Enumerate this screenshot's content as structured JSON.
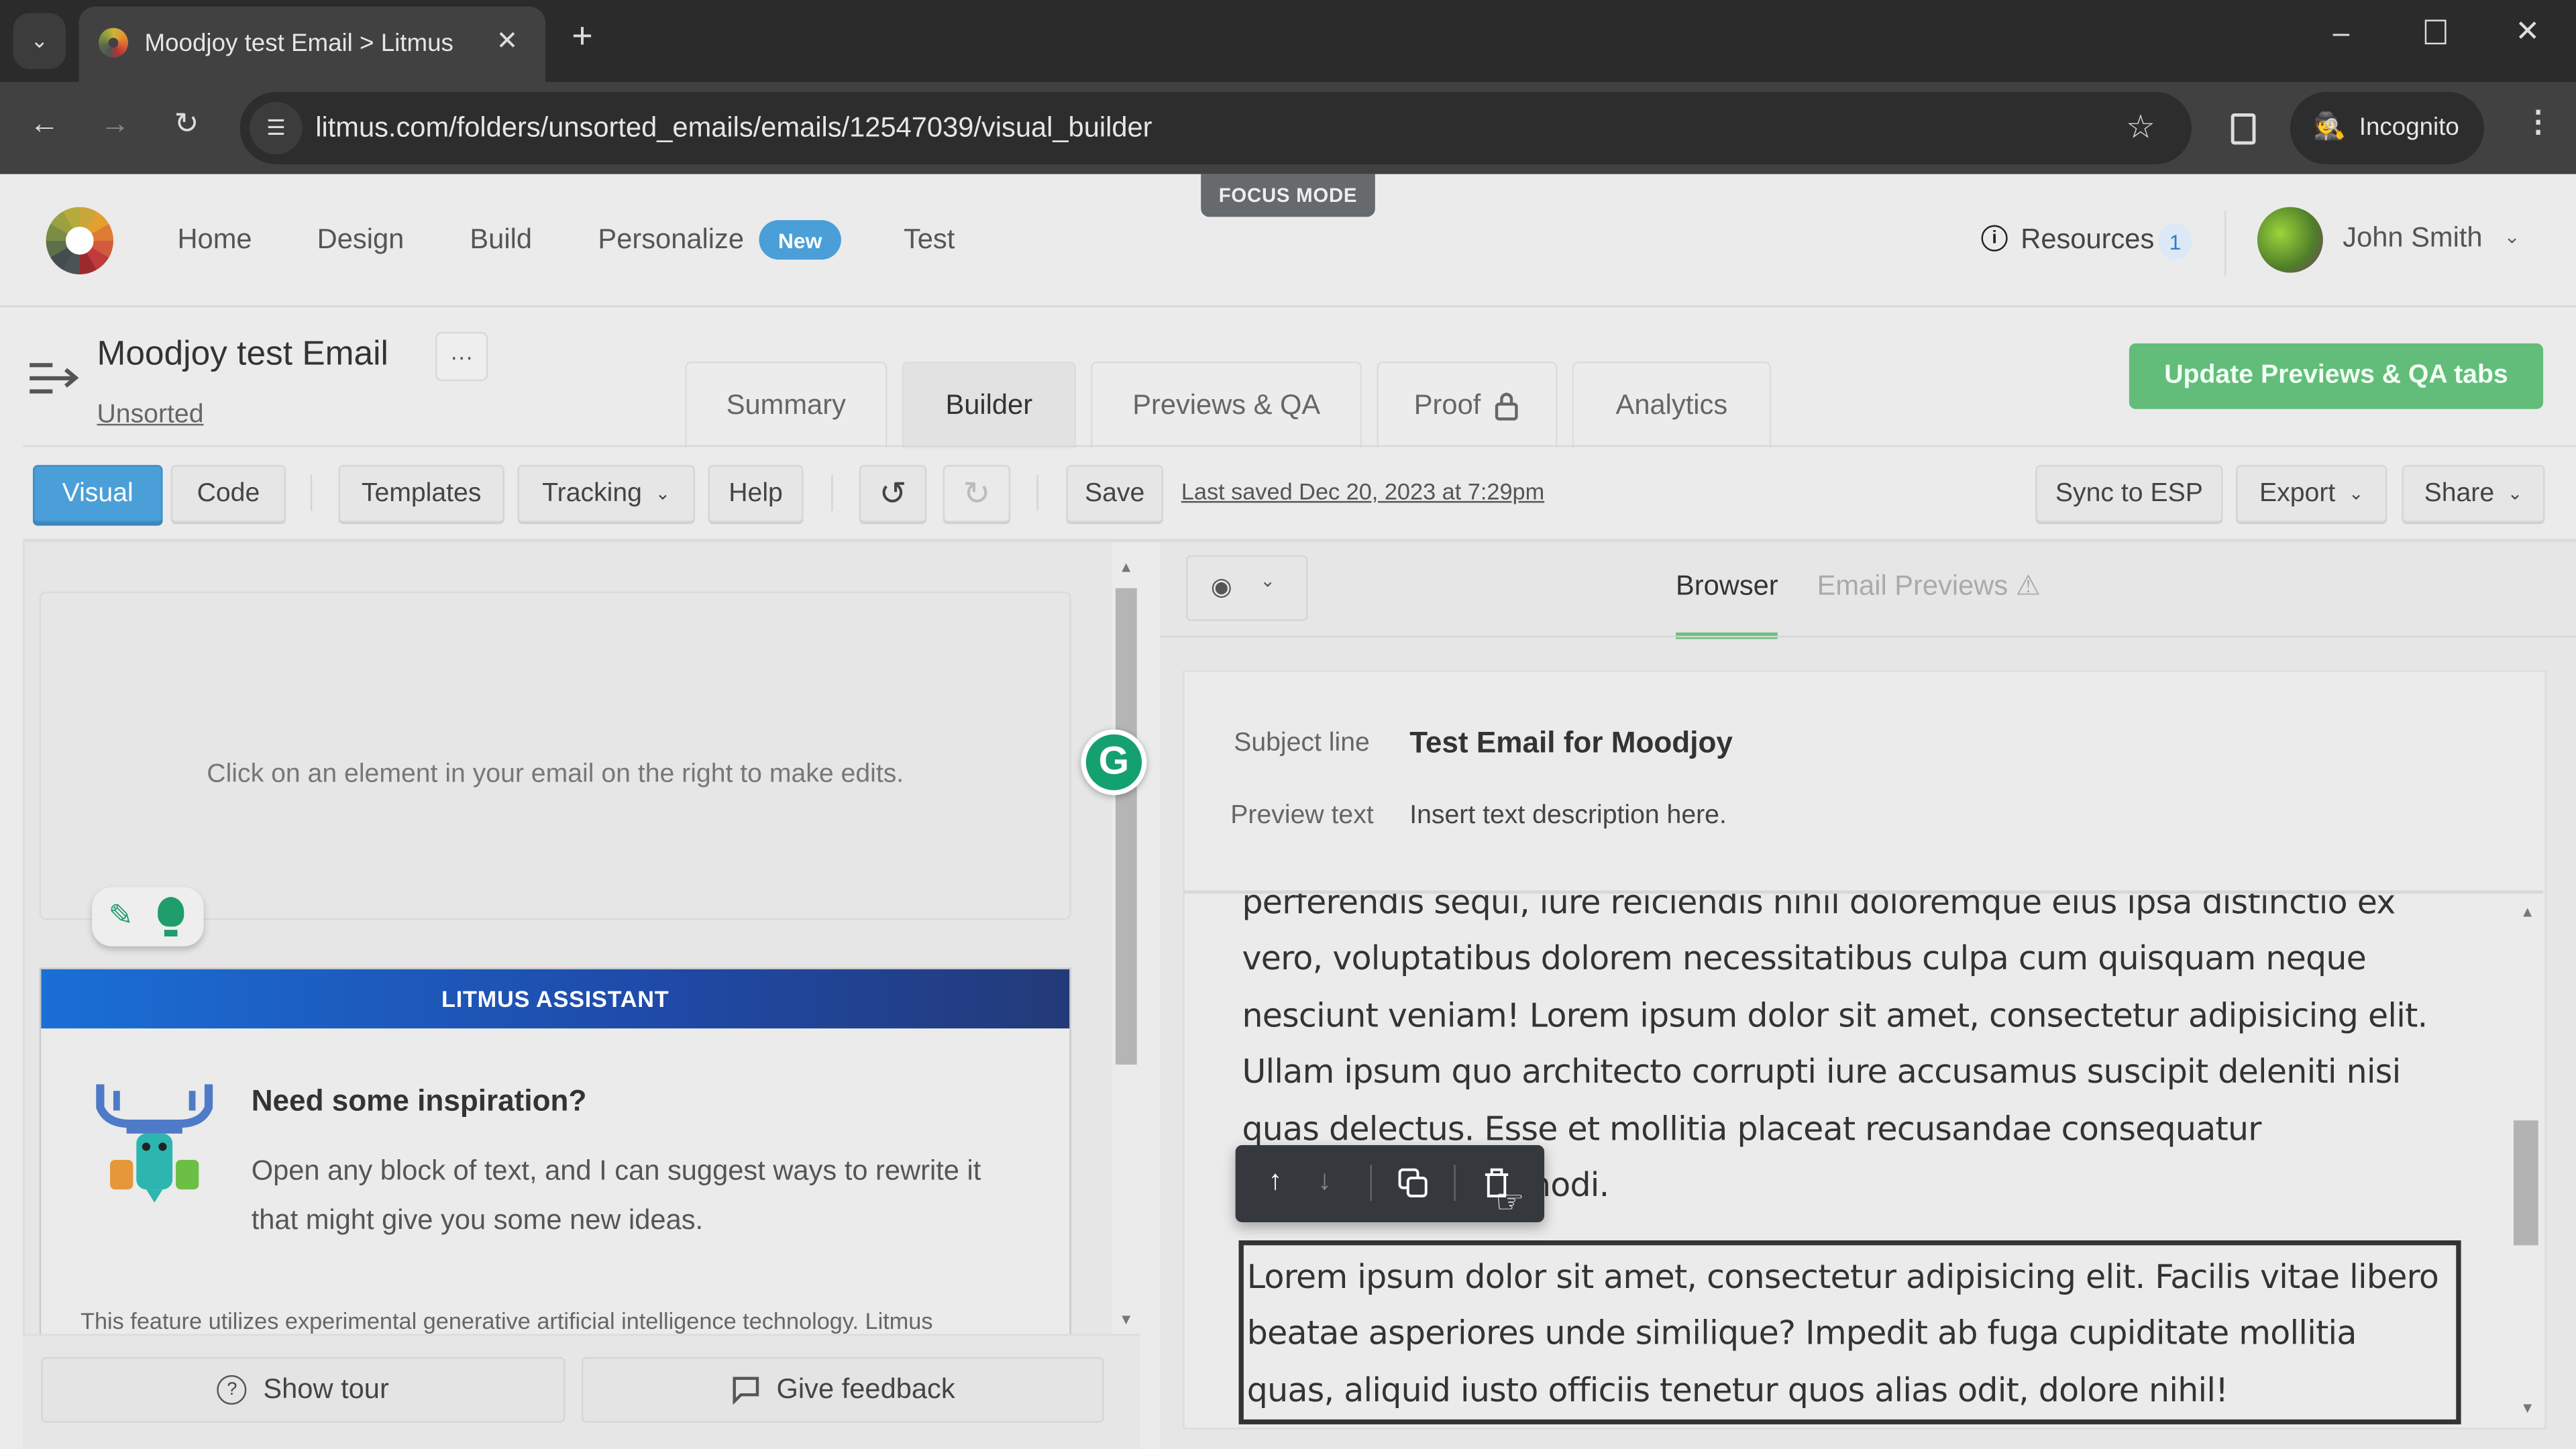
{
  "browser": {
    "tab_title": "Moodjoy test Email > Litmus",
    "url": "litmus.com/folders/unsorted_emails/emails/12547039/visual_builder",
    "profile_label": "Incognito"
  },
  "header": {
    "nav": [
      "Home",
      "Design",
      "Build",
      "Personalize",
      "Test"
    ],
    "new_badge": "New",
    "focus_mode": "FOCUS MODE",
    "resources_label": "Resources",
    "resources_count": "1",
    "user_name": "John Smith"
  },
  "email": {
    "title": "Moodjoy test Email",
    "more_label": "···",
    "folder": "Unsorted",
    "update_button": "Update Previews & QA tabs"
  },
  "page_tabs": [
    {
      "label": "Summary",
      "active": false
    },
    {
      "label": "Builder",
      "active": true
    },
    {
      "label": "Previews & QA",
      "active": false
    },
    {
      "label": "Proof",
      "active": false,
      "locked": true
    },
    {
      "label": "Analytics",
      "active": false
    }
  ],
  "toolbar": {
    "visual": "Visual",
    "code": "Code",
    "templates": "Templates",
    "tracking": "Tracking",
    "help": "Help",
    "save": "Save",
    "last_saved": "Last saved Dec 20, 2023 at 7:29pm",
    "sync": "Sync to ESP",
    "export": "Export",
    "share": "Share"
  },
  "left_panel": {
    "empty_message": "Click on an element in your email on the right to make edits.",
    "assistant_header": "LITMUS ASSISTANT",
    "assistant_title": "Need some inspiration?",
    "assistant_body": "Open any block of text, and I can suggest ways to rewrite it that might give you some new ideas.",
    "disclaimer": "This feature utilizes experimental generative artificial intelligence technology. Litmus",
    "show_tour": "Show tour",
    "give_feedback": "Give feedback"
  },
  "preview": {
    "tabs": {
      "browser": "Browser",
      "email_previews": "Email Previews"
    },
    "subject_label": "Subject line",
    "subject_value": "Test Email for Moodjoy",
    "preview_label": "Preview text",
    "preview_value": "Insert text description here.",
    "paragraph_1": "perferendis sequi, iure reiciendis nihil doloremque eius ipsa distinctio ex vero, voluptatibus dolorem necessitatibus culpa cum quisquam neque nesciunt veniam! Lorem ipsum dolor sit amet, consectetur adipisicing elit. Ullam ipsum quo architecto corrupti iure accusamus suscipit deleniti nisi quas delectus. Esse et mollitia placeat recusandae consequatur voluptatibus commodi.",
    "paragraph_2": "Lorem ipsum dolor sit amet, consectetur adipisicing elit. Facilis vitae libero beatae asperiores unde similique? Impedit ab fuga cupiditate mollitia quas, aliquid iusto officiis tenetur quos alias odit, dolore nihil!"
  },
  "colors": {
    "primary_blue": "#4a9fd8",
    "update_green": "#61bd79",
    "active_tab_underline": "#6cc07e",
    "assistant_gradient_start": "#1a6fd6",
    "assistant_gradient_end": "#233a78"
  }
}
